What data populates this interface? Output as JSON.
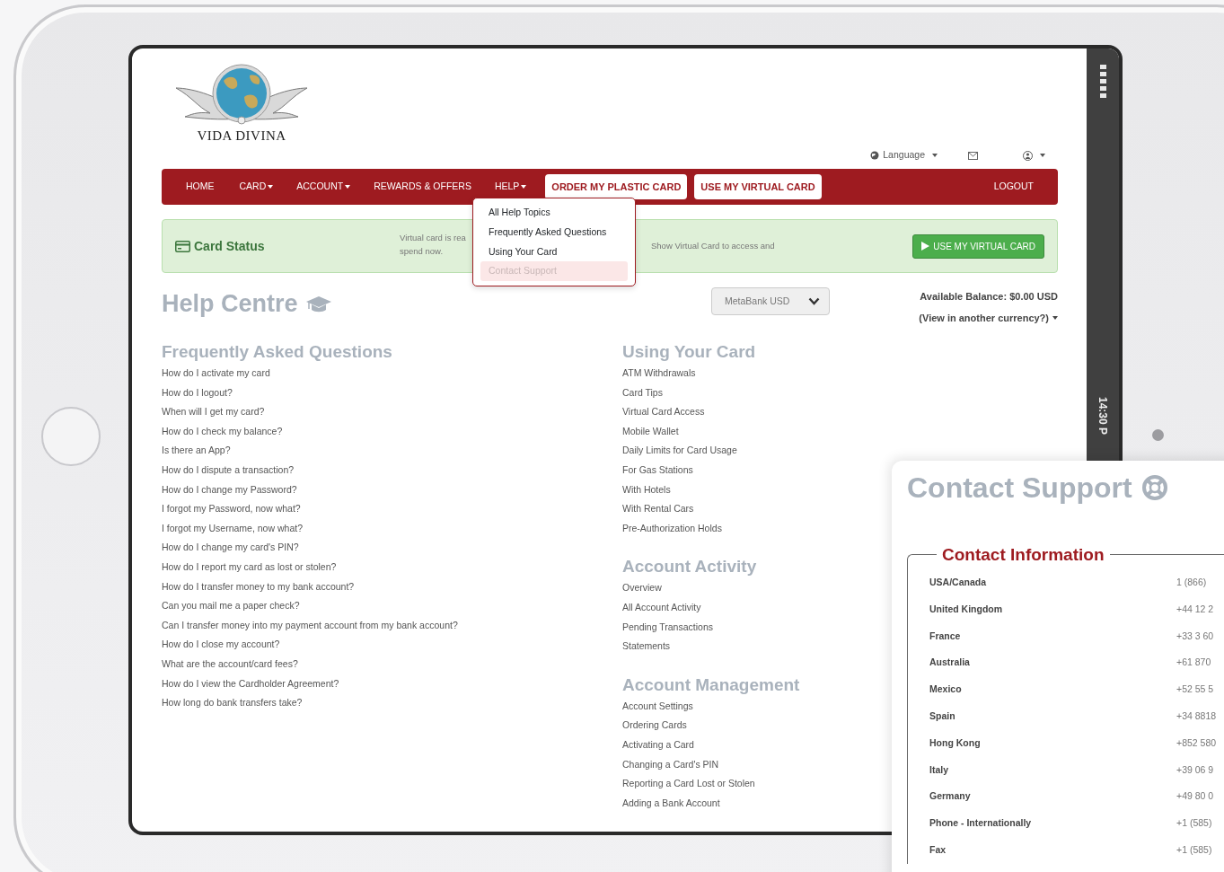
{
  "status_bar": {
    "time": "14:30 P"
  },
  "logo": {
    "text": "VIDA DIVINA"
  },
  "utility_nav": {
    "language": "Language"
  },
  "navbar": {
    "items": [
      {
        "label": "HOME",
        "kind": "link"
      },
      {
        "label": "CARD",
        "kind": "dropdown"
      },
      {
        "label": "ACCOUNT",
        "kind": "dropdown"
      },
      {
        "label": "REWARDS & OFFERS",
        "kind": "link"
      },
      {
        "label": "HELP",
        "kind": "dropdown",
        "menu": [
          {
            "label": "All Help Topics",
            "selected": false
          },
          {
            "label": "Frequently Asked Questions",
            "selected": false
          },
          {
            "label": "Using Your Card",
            "selected": false
          },
          {
            "label": "Contact Support",
            "selected": true
          }
        ]
      },
      {
        "label": "ORDER MY PLASTIC CARD",
        "kind": "button"
      },
      {
        "label": "USE MY VIRTUAL CARD",
        "kind": "button"
      }
    ],
    "logout": "LOGOUT"
  },
  "card_status": {
    "title": "Card Status",
    "message_lines": [
      "Virtual card is rea",
      "spend now."
    ],
    "message_right": "Show Virtual Card to access and",
    "button": "USE MY VIRTUAL CARD"
  },
  "help_centre": {
    "title": "Help Centre",
    "currency_select": "MetaBank USD",
    "balance": "Available Balance: $0.00 USD",
    "other_currency": "(View in another currency?)"
  },
  "faq": {
    "title": "Frequently Asked Questions",
    "items": [
      "How do I activate my card",
      "How do I logout?",
      "When will I get my card?",
      "How do I check my balance?",
      "Is there an App?",
      "How do I dispute a transaction?",
      "How do I change my Password?",
      "I forgot my Password, now what?",
      "I forgot my Username, now what?",
      "How do I change my card's PIN?",
      "How do I report my card as lost or stolen?",
      "How do I transfer money to my bank account?",
      "Can you mail me a paper check?",
      "Can I transfer money into my payment account from my bank account?",
      "How do I close my account?",
      "What are the account/card fees?",
      "How do I view the Cardholder Agreement?",
      "How long do bank transfers take?"
    ]
  },
  "topic_sections": [
    {
      "title": "Using Your Card",
      "items": [
        "ATM Withdrawals",
        "Card Tips",
        "Virtual Card Access",
        "Mobile Wallet",
        "Daily Limits for Card Usage",
        "For Gas Stations",
        "With Hotels",
        "With Rental Cars",
        "Pre-Authorization Holds"
      ]
    },
    {
      "title": "Account Activity",
      "items": [
        "Overview",
        "All Account Activity",
        "Pending Transactions",
        "Statements"
      ]
    },
    {
      "title": "Account Management",
      "items": [
        "Account Settings",
        "Ordering Cards",
        "Activating a Card",
        "Changing a Card's PIN",
        "Reporting a Card Lost or Stolen",
        "Adding a Bank Account"
      ]
    }
  ],
  "contact_panel": {
    "title": "Contact Support",
    "legend": "Contact Information",
    "rows": [
      {
        "country": "USA/Canada",
        "phone": "1 (866)"
      },
      {
        "country": "United Kingdom",
        "phone": "+44 12 2"
      },
      {
        "country": "France",
        "phone": "+33 3 60"
      },
      {
        "country": "Australia",
        "phone": "+61 870"
      },
      {
        "country": "Mexico",
        "phone": "+52 55 5"
      },
      {
        "country": "Spain",
        "phone": "+34 8818"
      },
      {
        "country": "Hong Kong",
        "phone": "+852 580"
      },
      {
        "country": "Italy",
        "phone": "+39 06 9"
      },
      {
        "country": "Germany",
        "phone": "+49 80 0"
      },
      {
        "country": "Phone - Internationally",
        "phone": "+1 (585)"
      },
      {
        "country": "Fax",
        "phone": "+1 (585)"
      }
    ]
  }
}
